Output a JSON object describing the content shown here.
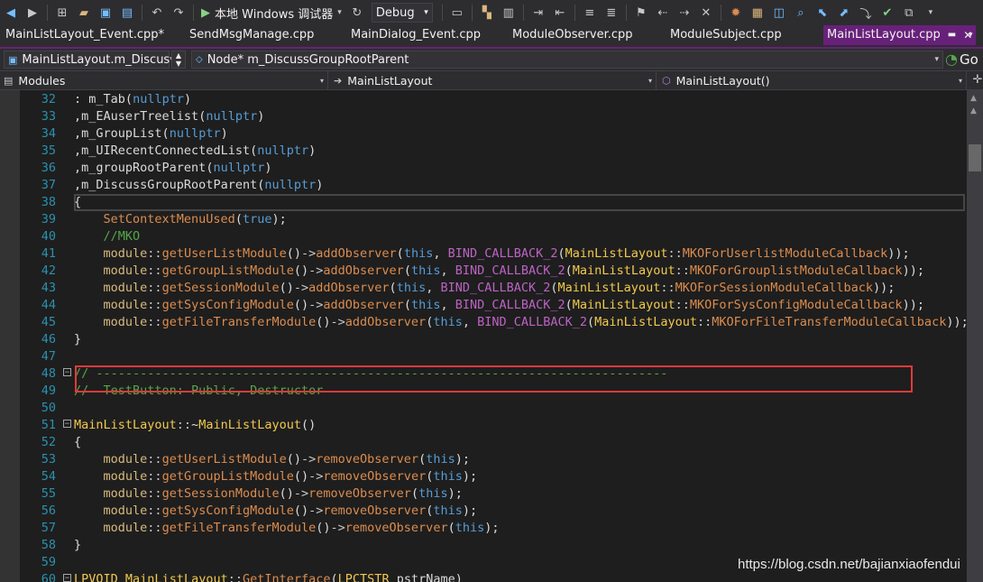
{
  "toolbar": {
    "run_label": "本地 Windows 调试器",
    "config": "Debug",
    "buttons": [
      "back-icon",
      "forward-icon",
      "new-project-icon",
      "open-icon",
      "save-icon",
      "save-all-icon",
      "undo-icon",
      "redo-icon"
    ]
  },
  "tabs": [
    {
      "label": "MainListLayout_Event.cpp*",
      "active": false
    },
    {
      "label": "SendMsgManage.cpp",
      "active": false
    },
    {
      "label": "MainDialog_Event.cpp",
      "active": false
    },
    {
      "label": "ModuleObserver.cpp",
      "active": false
    },
    {
      "label": "ModuleSubject.cpp",
      "active": false
    },
    {
      "label": "MainListLayout.cpp",
      "active": true
    }
  ],
  "nav": {
    "class_scope": "MainListLayout.m_Discus",
    "member": "Node* m_DiscussGroupRootParent",
    "go_label": "Go"
  },
  "scope": {
    "project": "Modules",
    "class": "MainListLayout",
    "function": "MainListLayout()"
  },
  "code_lines": [
    {
      "n": "32",
      "text": ": m_Tab(nullptr)"
    },
    {
      "n": "33",
      "text": ",m_EAuserTreelist(nullptr)"
    },
    {
      "n": "34",
      "text": ",m_GroupList(nullptr)"
    },
    {
      "n": "35",
      "text": ",m_UIRecentConnectedList(nullptr)"
    },
    {
      "n": "36",
      "text": ",m_groupRootParent(nullptr)"
    },
    {
      "n": "37",
      "text": ",m_DiscussGroupRootParent(nullptr)"
    },
    {
      "n": "38",
      "text": "{"
    },
    {
      "n": "39",
      "text": "    SetContextMenuUsed(true);"
    },
    {
      "n": "40",
      "text": "    //MKO"
    },
    {
      "n": "41",
      "text": "    module::getUserListModule()->addObserver(this, BIND_CALLBACK_2(MainListLayout::MKOForUserlistModuleCallback));"
    },
    {
      "n": "42",
      "text": "    module::getGroupListModule()->addObserver(this, BIND_CALLBACK_2(MainListLayout::MKOForGrouplistModuleCallback));"
    },
    {
      "n": "43",
      "text": "    module::getSessionModule()->addObserver(this, BIND_CALLBACK_2(MainListLayout::MKOForSessionModuleCallback));"
    },
    {
      "n": "44",
      "text": "    module::getSysConfigModule()->addObserver(this, BIND_CALLBACK_2(MainListLayout::MKOForSysConfigModuleCallback));"
    },
    {
      "n": "45",
      "text": "    module::getFileTransferModule()->addObserver(this, BIND_CALLBACK_2(MainListLayout::MKOForFileTransferModuleCallback));"
    },
    {
      "n": "46",
      "text": "}"
    },
    {
      "n": "47",
      "text": ""
    },
    {
      "n": "48",
      "text": "// ------------------------------------------------------------------------------"
    },
    {
      "n": "49",
      "text": "//  TestButton: Public, Destructor"
    },
    {
      "n": "50",
      "text": ""
    },
    {
      "n": "51",
      "text": "MainListLayout::~MainListLayout()"
    },
    {
      "n": "52",
      "text": "{"
    },
    {
      "n": "53",
      "text": "    module::getUserListModule()->removeObserver(this);"
    },
    {
      "n": "54",
      "text": "    module::getGroupListModule()->removeObserver(this);"
    },
    {
      "n": "55",
      "text": "    module::getSessionModule()->removeObserver(this);"
    },
    {
      "n": "56",
      "text": "    module::getSysConfigModule()->removeObserver(this);"
    },
    {
      "n": "57",
      "text": "    module::getFileTransferModule()->removeObserver(this);"
    },
    {
      "n": "58",
      "text": "}"
    },
    {
      "n": "59",
      "text": ""
    },
    {
      "n": "60",
      "text": "LPVOID MainListLayout::GetInterface(LPCTSTR pstrName)"
    }
  ],
  "watermark": "https://blog.csdn.net/bajianxiaofendui",
  "colors": {
    "accent": "#68217a",
    "highlight_box": "#e03a3a",
    "line_number": "#2b91af"
  }
}
